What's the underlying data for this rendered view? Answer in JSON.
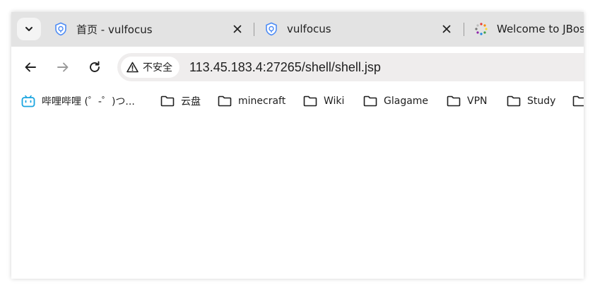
{
  "tabs": [
    {
      "title": "首页 - vulfocus",
      "icon": "vulfocus-shield-icon"
    },
    {
      "title": "vulfocus",
      "icon": "vulfocus-shield-icon"
    },
    {
      "title": "Welcome to JBoss",
      "icon": "jboss-spinner-icon"
    }
  ],
  "toolbar": {
    "security_label": "不安全",
    "url": "113.45.183.4:27265/shell/shell.jsp"
  },
  "bookmarks": [
    {
      "label": "哔哩哔哩 (゜-゜)つ...",
      "icon": "bilibili-icon"
    },
    {
      "label": "云盘",
      "icon": "folder-icon"
    },
    {
      "label": "minecraft",
      "icon": "folder-icon"
    },
    {
      "label": "Wiki",
      "icon": "folder-icon"
    },
    {
      "label": "Glagame",
      "icon": "folder-icon"
    },
    {
      "label": "VPN",
      "icon": "folder-icon"
    },
    {
      "label": "Study",
      "icon": "folder-icon"
    }
  ],
  "colors": {
    "tabstrip": "#e3e3e3",
    "omnibox": "#efeded",
    "shield": "#4c8bf5",
    "bilibili": "#1aa5e0"
  }
}
